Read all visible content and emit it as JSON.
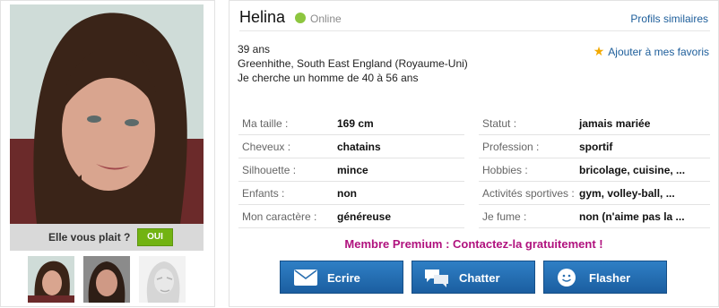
{
  "profile": {
    "name": "Helina",
    "status": "Online",
    "similar_link": "Profils similaires",
    "favorite_link": "Ajouter à mes favoris",
    "age": "39 ans",
    "location": "Greenhithe, South East England (Royaume-Uni)",
    "seeking": "Je cherche un homme de 40 à 56 ans"
  },
  "vote": {
    "question": "Elle vous plait ?",
    "yes_label": "OUI"
  },
  "attributes_left": [
    {
      "label": "Ma taille :",
      "value": "169 cm"
    },
    {
      "label": "Cheveux :",
      "value": "chatains"
    },
    {
      "label": "Silhouette :",
      "value": "mince"
    },
    {
      "label": "Enfants :",
      "value": "non"
    },
    {
      "label": "Mon caractère :",
      "value": "généreuse"
    }
  ],
  "attributes_right": [
    {
      "label": "Statut :",
      "value": "jamais mariée"
    },
    {
      "label": "Profession :",
      "value": "sportif"
    },
    {
      "label": "Hobbies :",
      "value": "bricolage, cuisine, ..."
    },
    {
      "label": "Activités sportives :",
      "value": "gym, volley-ball, ..."
    },
    {
      "label": "Je fume :",
      "value": "non (n'aime pas la ..."
    }
  ],
  "premium_text": "Membre Premium : Contactez-la gratuitement !",
  "actions": {
    "write": "Ecrire",
    "chat": "Chatter",
    "flash": "Flasher"
  },
  "colors": {
    "accent_blue": "#1b5ea0",
    "link_blue": "#1c5d9a",
    "online_green": "#8dc63f",
    "vote_green": "#72b312",
    "premium_magenta": "#b0127e"
  },
  "icons": [
    "envelope-icon",
    "chat-bubbles-icon",
    "smiley-icon",
    "star-icon"
  ]
}
